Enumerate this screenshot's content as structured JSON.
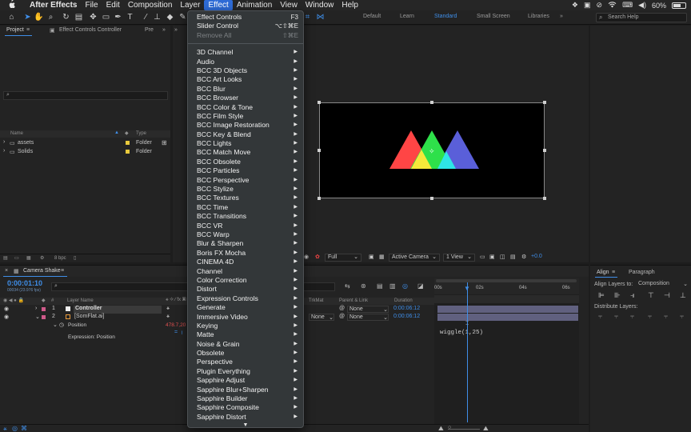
{
  "menubar": {
    "apple": "",
    "items": [
      "After Effects",
      "File",
      "Edit",
      "Composition",
      "Layer",
      "Effect",
      "Animation",
      "View",
      "Window",
      "Help"
    ],
    "active_index": 5,
    "battery": "60%"
  },
  "toolbar": {
    "workspaces": [
      "Default",
      "Learn",
      "Standard",
      "Small Screen",
      "Libraries"
    ],
    "active_workspace": "Standard",
    "search_placeholder": "Search Help"
  },
  "project": {
    "tabs": [
      "Project",
      "Effect Controls Controller",
      "Pre"
    ],
    "columns": {
      "name": "Name",
      "type": "Type"
    },
    "items": [
      {
        "name": "assets",
        "type": "Folder"
      },
      {
        "name": "Solids",
        "type": "Folder"
      }
    ],
    "bpc": "8 bpc"
  },
  "viewer": {
    "resolution": "Full",
    "camera": "Active Camera",
    "view": "1 View",
    "exposure": "+0.0"
  },
  "timeline": {
    "tab": "Camera Shake",
    "time": "0:00:01:10",
    "fps": "00034 (23.976 fps)",
    "columns": {
      "num": "#",
      "layer_name": "Layer Name",
      "trkmat": "TrkMat",
      "parent": "Parent & Link",
      "duration": "Duration"
    },
    "layers": [
      {
        "num": "1",
        "name": "Controller",
        "parent": "None",
        "duration": "0:00:06:12"
      },
      {
        "num": "2",
        "name": "[SomFlat.ai]",
        "trkmat": "None",
        "parent": "None",
        "duration": "0:00:06:12"
      }
    ],
    "property": {
      "name": "Position",
      "value": "478.7,20"
    },
    "expression_label": "Expression: Position",
    "expression_code": "wiggle(1,25)",
    "ruler": [
      "00s",
      "02s",
      "04s",
      "06s"
    ]
  },
  "align": {
    "tabs": [
      "Align",
      "Paragraph"
    ],
    "align_layers_to_label": "Align Layers to:",
    "align_layers_to_value": "Composition",
    "distribute_label": "Distribute Layers:"
  },
  "effect_menu": {
    "top_items": [
      {
        "label": "Effect Controls",
        "shortcut": "F3",
        "disabled": false
      },
      {
        "label": "Slider Control",
        "shortcut": "⌥⇧⌘E",
        "disabled": false
      },
      {
        "label": "Remove All",
        "shortcut": "⇧⌘E",
        "disabled": true
      }
    ],
    "submenus": [
      "3D Channel",
      "Audio",
      "BCC 3D Objects",
      "BCC Art Looks",
      "BCC Blur",
      "BCC Browser",
      "BCC Color & Tone",
      "BCC Film Style",
      "BCC Image Restoration",
      "BCC Key & Blend",
      "BCC Lights",
      "BCC Match Move",
      "BCC Obsolete",
      "BCC Particles",
      "BCC Perspective",
      "BCC Stylize",
      "BCC Textures",
      "BCC Time",
      "BCC Transitions",
      "BCC VR",
      "BCC Warp",
      "Blur & Sharpen",
      "Boris FX Mocha",
      "CINEMA 4D",
      "Channel",
      "Color Correction",
      "Distort",
      "Expression Controls",
      "Generate",
      "Immersive Video",
      "Keying",
      "Matte",
      "Noise & Grain",
      "Obsolete",
      "Perspective",
      "Plugin Everything",
      "Sapphire Adjust",
      "Sapphire Blur+Sharpen",
      "Sapphire Builder",
      "Sapphire Composite",
      "Sapphire Distort"
    ],
    "more_indicator": "▼"
  },
  "colors": {
    "accent": "#3f8ee8",
    "menu_bg": "#333739",
    "tri_red": "#ff4545",
    "tri_green": "#2ee04a",
    "tri_blue": "#5a5fd9",
    "tri_yellow": "#f5e93a",
    "tri_cyan": "#2ee6e6"
  }
}
